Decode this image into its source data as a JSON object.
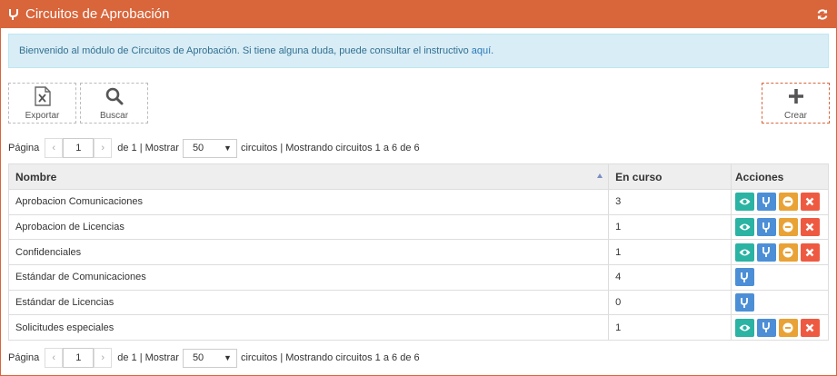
{
  "header": {
    "title": "Circuitos de Aprobación"
  },
  "alert": {
    "text": "Bienvenido al módulo de Circuitos de Aprobación. Si tiene alguna duda, puede consultar el instructivo",
    "link": "aquí",
    "suffix": "."
  },
  "toolbar": {
    "export_label": "Exportar",
    "search_label": "Buscar",
    "create_label": "Crear"
  },
  "pager": {
    "page_label": "Página",
    "page_value": "1",
    "of_label": "de 1 | Mostrar",
    "page_size": "50",
    "summary": "circuitos | Mostrando circuitos 1 a 6 de 6",
    "prev": "‹",
    "next": "›"
  },
  "table": {
    "headers": {
      "name": "Nombre",
      "count": "En curso",
      "actions": "Acciones"
    },
    "rows": [
      {
        "name": "Aprobacion Comunicaciones",
        "count": "3",
        "actions": [
          "view",
          "flow",
          "disable",
          "delete"
        ]
      },
      {
        "name": "Aprobacion de Licencias",
        "count": "1",
        "actions": [
          "view",
          "flow",
          "disable",
          "delete"
        ]
      },
      {
        "name": "Confidenciales",
        "count": "1",
        "actions": [
          "view",
          "flow",
          "disable",
          "delete"
        ]
      },
      {
        "name": "Estándar de Comunicaciones",
        "count": "4",
        "actions": [
          "flow"
        ]
      },
      {
        "name": "Estándar de Licencias",
        "count": "0",
        "actions": [
          "flow"
        ]
      },
      {
        "name": "Solicitudes especiales",
        "count": "1",
        "actions": [
          "view",
          "flow",
          "disable",
          "delete"
        ]
      }
    ]
  },
  "icons": {
    "title": "flow-fork-icon",
    "refresh": "refresh-icon",
    "export": "excel-file-icon",
    "search": "search-icon",
    "create": "plus-icon",
    "view": "eye-icon",
    "flow": "flow-fork-icon",
    "disable": "minus-circle-icon",
    "delete": "close-icon"
  },
  "colors": {
    "brand": "#d9653b",
    "view": "#2bb3a3",
    "flow": "#4c8fd6",
    "disable": "#e9a235",
    "delete": "#ee5a41",
    "alert_bg": "#d9edf7"
  }
}
